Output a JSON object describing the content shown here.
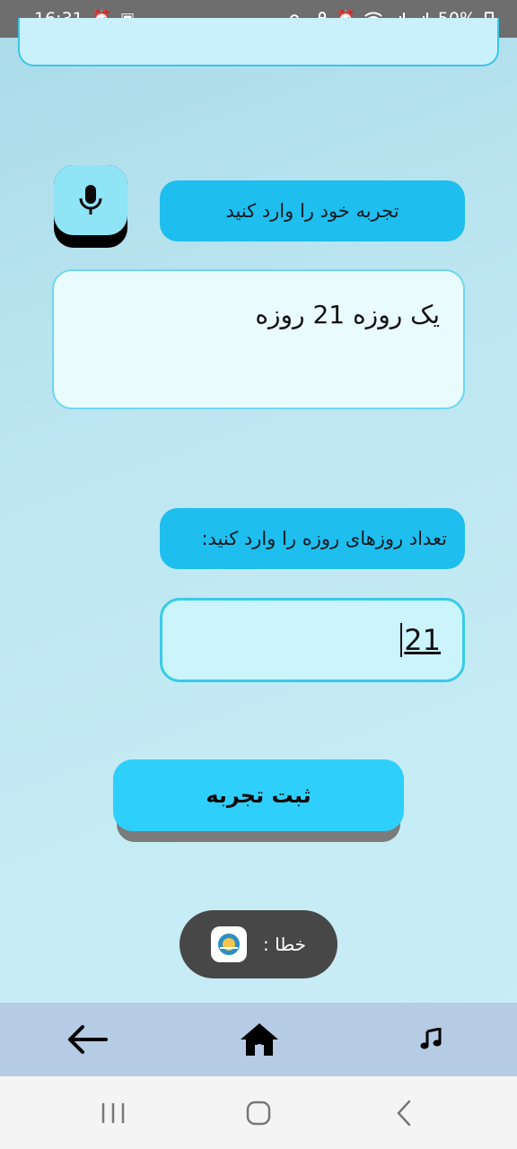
{
  "status_bar": {
    "time": "16:31",
    "battery": "50%",
    "left_icons": [
      "alarm-icon",
      "image-icon"
    ],
    "right_icons": [
      "key-icon",
      "lock-icon",
      "alarm-icon",
      "wifi-icon",
      "signal-icon",
      "signal-icon"
    ]
  },
  "experience": {
    "label": "تجربه خود را وارد کنید",
    "value": "یک روزه 21 روزه"
  },
  "days": {
    "label": "تعداد روزهای روزه را وارد کنید:",
    "value": "21"
  },
  "submit": {
    "label": "ثبت تجربه"
  },
  "toast": {
    "text": "خطا :"
  },
  "bottom_nav": {
    "items": [
      "back-arrow-icon",
      "home-icon",
      "music-note-icon"
    ]
  },
  "colors": {
    "accent": "#1ebeee",
    "submit": "#2ecffb",
    "nav_bar": "#b6cbe4"
  }
}
